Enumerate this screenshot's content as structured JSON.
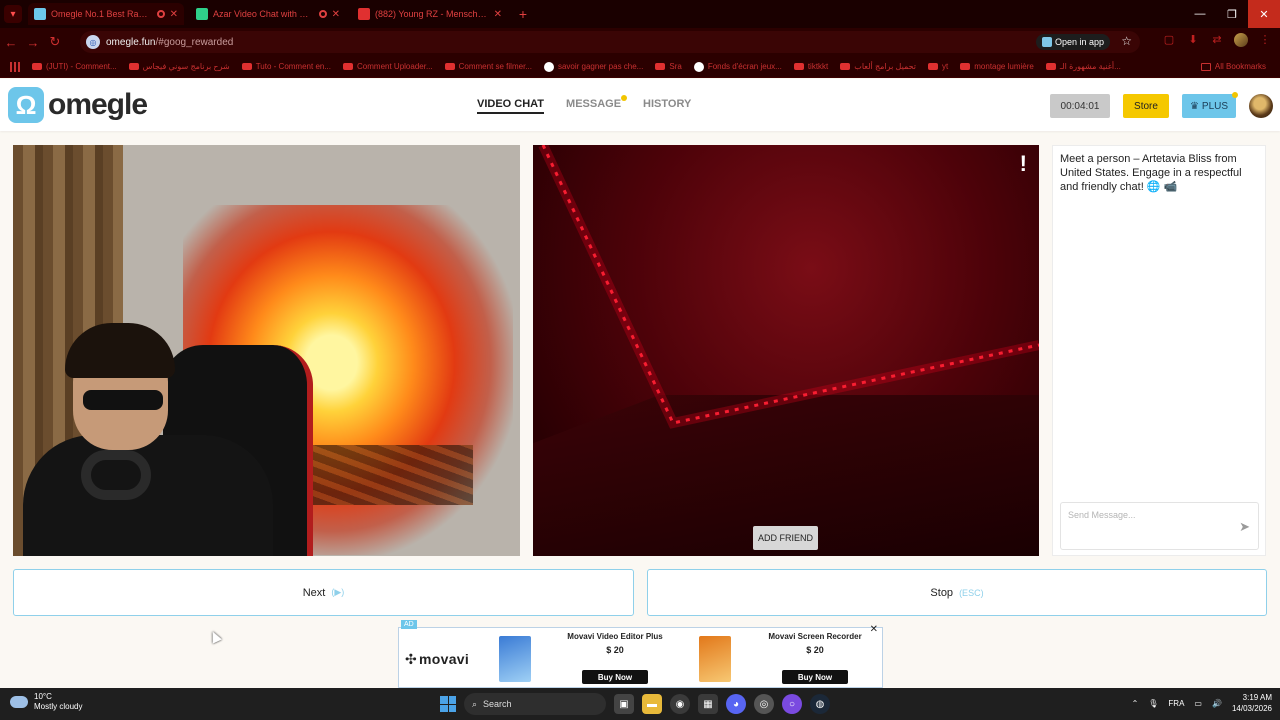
{
  "browser": {
    "tabs": [
      {
        "title": "Omegle No.1 Best Rando...",
        "active": true
      },
      {
        "title": "Azar Video Chat with New...",
        "active": false
      },
      {
        "title": "(882) Young RZ - Mensch Kh...",
        "active": false
      }
    ],
    "new_tab_glyph": "+",
    "url_host": "omegle.fun",
    "url_path": "/#goog_rewarded",
    "open_in_app_label": "Open in app",
    "bookmarks": [
      "(JUTI) - Comment...",
      "شرح برنامج سوني فيجاس",
      "Tuto - Comment en...",
      "Comment Uploader...",
      "Comment se filmer...",
      "savoir gagner pas che...",
      "Sra",
      "Fonds d'écran jeux...",
      "tiktkkt",
      "تحميل برامج ألعاب",
      "yt",
      "montage lumière",
      "أغنية مشهورة الـ..."
    ],
    "all_bookmarks_label": "All Bookmarks"
  },
  "site": {
    "logo_mark": "Ω",
    "logo_text": "omegle",
    "nav": {
      "video_chat": "VIDEO CHAT",
      "message": "MESSAGE",
      "history": "HISTORY"
    },
    "timer": "00:04:01",
    "store_label": "Store",
    "plus_label": "PLUS",
    "plus_icon": "♛"
  },
  "video": {
    "report_glyph": "!",
    "add_friend_label": "ADD FRIEND"
  },
  "chat": {
    "message": "Meet a person – Artetavia Bliss from United States. Engage in a respectful and friendly chat! 🌐 📹",
    "input_placeholder": "Send Message...",
    "send_glyph": "➤"
  },
  "controls": {
    "next_label": "Next",
    "next_hint": "(▶)",
    "stop_label": "Stop",
    "stop_hint": "(ESC)"
  },
  "ad": {
    "tag": "AD",
    "brand": "movavi",
    "products": [
      {
        "name": "Movavi Video Editor Plus",
        "price": "$ 20",
        "cta": "Buy Now"
      },
      {
        "name": "Movavi Screen Recorder",
        "price": "$ 20",
        "cta": "Buy Now"
      }
    ]
  },
  "taskbar": {
    "temperature": "10°C",
    "weather": "Mostly cloudy",
    "search_label": "Search",
    "lang": "FRA",
    "time": "3:19 AM",
    "date": "14/03/2026"
  },
  "colors": {
    "accent_blue": "#6dc6ea",
    "store_yellow": "#f5c800",
    "browser_red": "#e04040"
  }
}
